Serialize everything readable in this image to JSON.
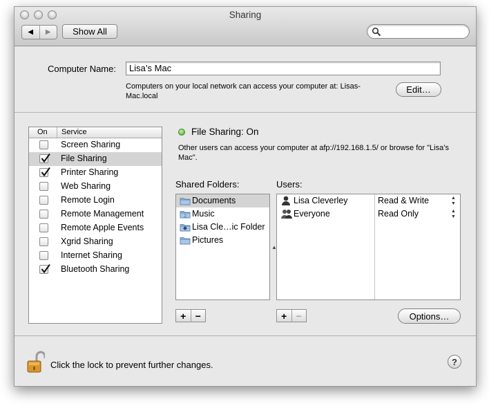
{
  "window": {
    "title": "Sharing"
  },
  "toolbar": {
    "back_glyph": "◀",
    "forward_glyph": "▶",
    "show_all_label": "Show All",
    "search_value": "",
    "search_placeholder": ""
  },
  "computer_name": {
    "label": "Computer Name:",
    "value": "Lisa’s Mac",
    "description": "Computers on your local network can access your computer at: Lisas-Mac.local",
    "edit_label": "Edit…"
  },
  "services": {
    "header_on": "On",
    "header_service": "Service",
    "items": [
      {
        "label": "Screen Sharing",
        "checked": false,
        "selected": false
      },
      {
        "label": "File Sharing",
        "checked": true,
        "selected": true
      },
      {
        "label": "Printer Sharing",
        "checked": true,
        "selected": false
      },
      {
        "label": "Web Sharing",
        "checked": false,
        "selected": false
      },
      {
        "label": "Remote Login",
        "checked": false,
        "selected": false
      },
      {
        "label": "Remote Management",
        "checked": false,
        "selected": false
      },
      {
        "label": "Remote Apple Events",
        "checked": false,
        "selected": false
      },
      {
        "label": "Xgrid Sharing",
        "checked": false,
        "selected": false
      },
      {
        "label": "Internet Sharing",
        "checked": false,
        "selected": false
      },
      {
        "label": "Bluetooth Sharing",
        "checked": true,
        "selected": false
      }
    ]
  },
  "detail": {
    "status_color": "#3aa51f",
    "status": "File Sharing: On",
    "description": "Other users can access your computer at afp://192.168.1.5/ or browse for \"Lisa’s Mac\".",
    "shared_folders_label": "Shared Folders:",
    "users_label": "Users:",
    "folders": [
      {
        "name": "Documents",
        "selected": true,
        "icon": "folder-icon"
      },
      {
        "name": "Music",
        "selected": false,
        "icon": "music-folder-icon"
      },
      {
        "name": "Lisa Cle…ic Folder",
        "selected": false,
        "icon": "public-folder-icon"
      },
      {
        "name": "Pictures",
        "selected": false,
        "icon": "folder-icon"
      }
    ],
    "users": [
      {
        "name": "Lisa Cleverley",
        "permission": "Read & Write",
        "icon": "user-icon"
      },
      {
        "name": "Everyone",
        "permission": "Read Only",
        "icon": "group-icon"
      }
    ],
    "add_label": "+",
    "remove_label": "−",
    "options_label": "Options…"
  },
  "bottom": {
    "lock_text": "Click the lock to prevent further changes.",
    "help_label": "?"
  }
}
